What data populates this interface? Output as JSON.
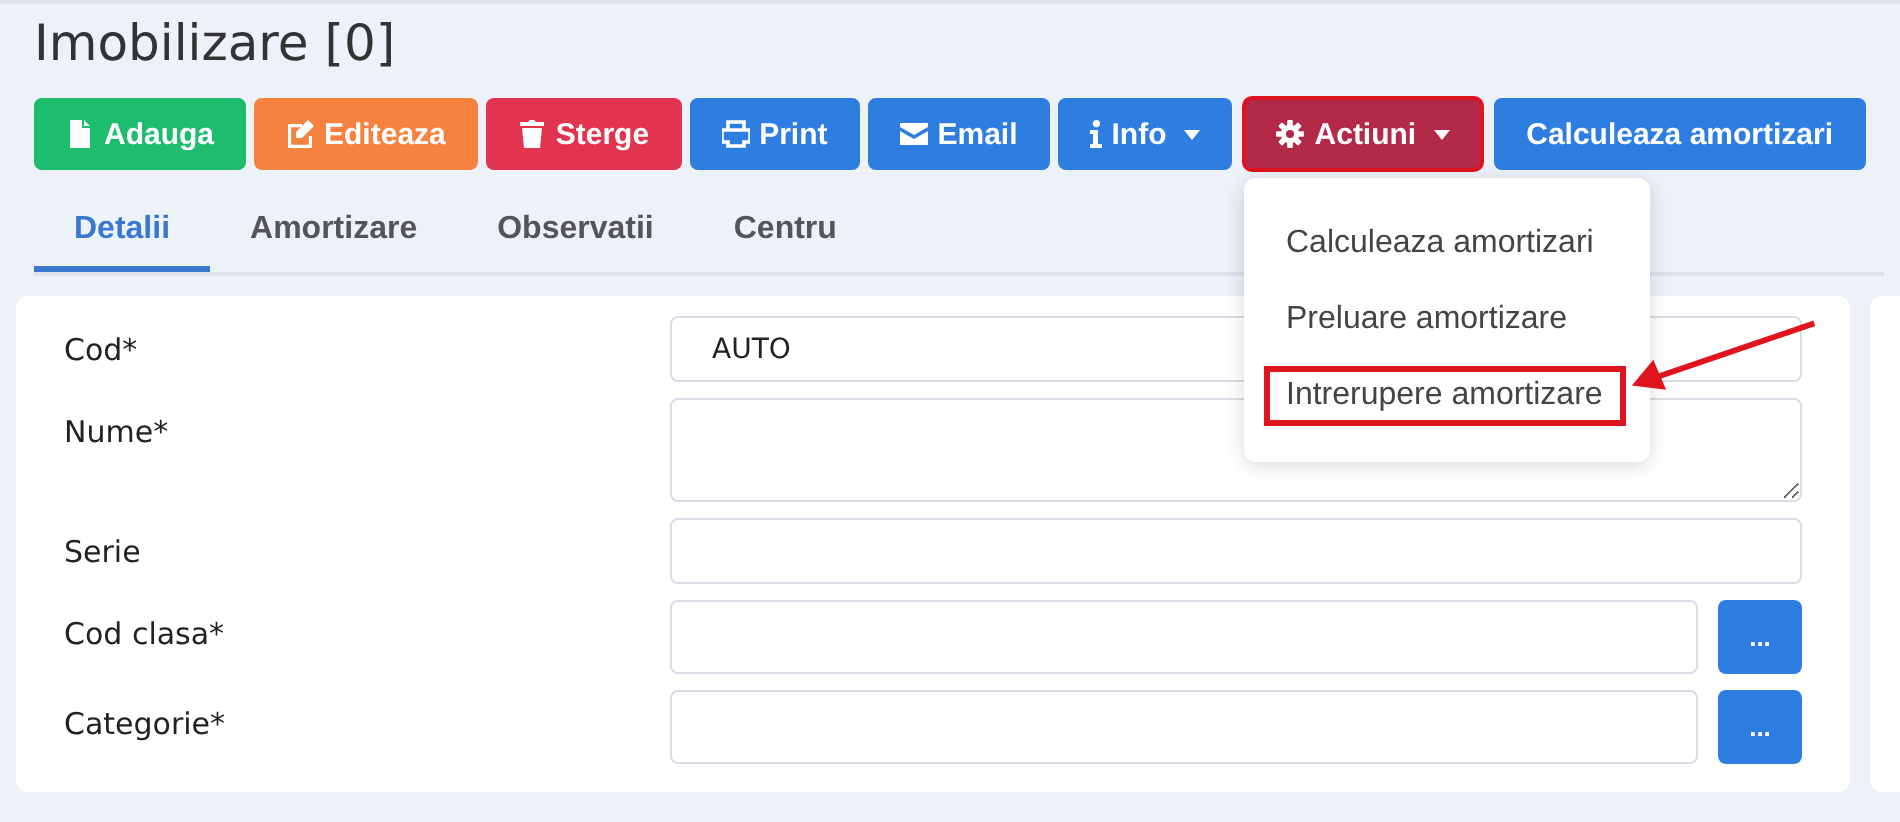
{
  "title": "Imobilizare [0]",
  "buttons": [
    {
      "label": "Adauga",
      "color": "#1ebd6d",
      "dropdown": false,
      "highlighted": false
    },
    {
      "label": "Editeaza",
      "color": "#f5823f",
      "dropdown": false,
      "highlighted": false
    },
    {
      "label": "Sterge",
      "color": "#e3344f",
      "dropdown": false,
      "highlighted": false
    },
    {
      "label": "Print",
      "color": "#2e7de1",
      "dropdown": false,
      "highlighted": false
    },
    {
      "label": "Email",
      "color": "#2e7de1",
      "dropdown": false,
      "highlighted": false
    },
    {
      "label": "Info",
      "color": "#2e7de1",
      "dropdown": true,
      "highlighted": false
    },
    {
      "label": "Actiuni",
      "color": "#b22a47",
      "dropdown": true,
      "highlighted": true
    },
    {
      "label": "Calculeaza amortizari",
      "color": "#2e7de1",
      "dropdown": false,
      "highlighted": false
    }
  ],
  "tabs": [
    {
      "label": "Detalii",
      "selected": true
    },
    {
      "label": "Amortizare",
      "selected": false
    },
    {
      "label": "Observatii",
      "selected": false
    },
    {
      "label": "Centru",
      "selected": false
    }
  ],
  "form": [
    {
      "label": "Cod*",
      "kind": "input",
      "value": "AUTO"
    },
    {
      "label": "Nume*",
      "kind": "textarea"
    },
    {
      "label": "Serie",
      "kind": "input"
    },
    {
      "label": "Cod clasa*",
      "kind": "lookup",
      "button": "..."
    },
    {
      "label": "Categorie*",
      "kind": "lookup",
      "button": "..."
    }
  ],
  "menu": {
    "items": [
      {
        "label": "Calculeaza amortizari",
        "highlighted": false
      },
      {
        "label": "Preluare amortizare",
        "highlighted": false
      },
      {
        "label": "Intrerupere amortizare",
        "highlighted": true
      }
    ]
  }
}
